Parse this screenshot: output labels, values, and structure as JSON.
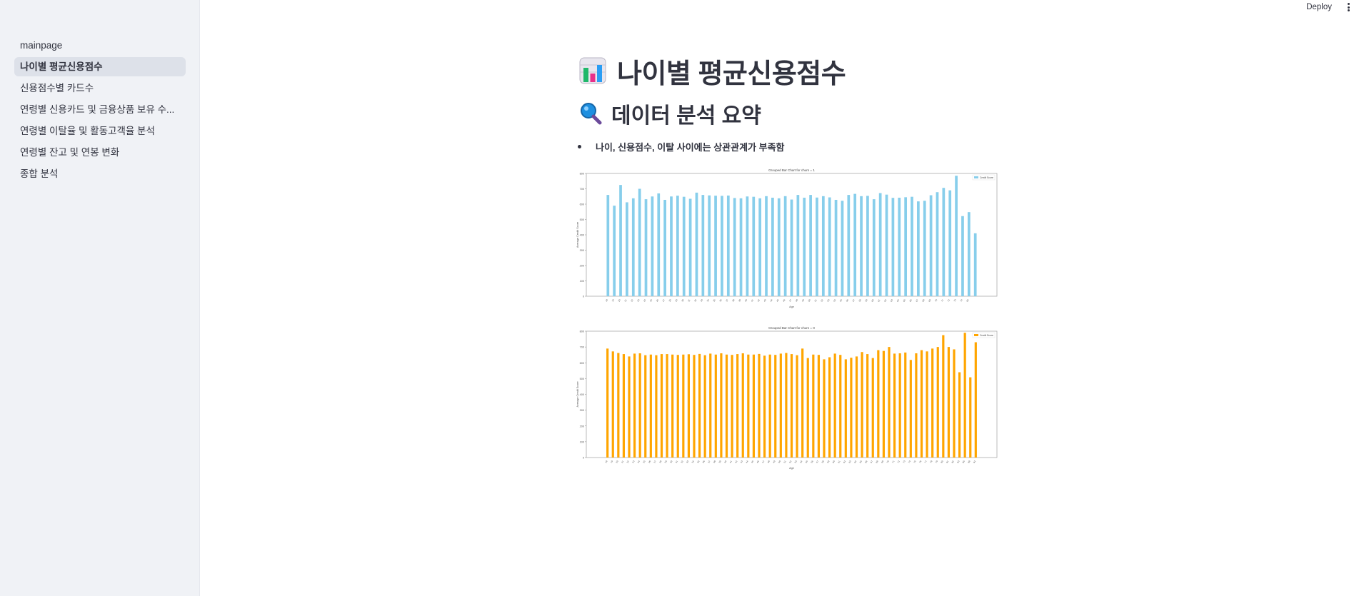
{
  "sidebar": {
    "items": [
      {
        "label": "mainpage",
        "active": false
      },
      {
        "label": "나이별 평균신용점수",
        "active": true
      },
      {
        "label": "신용점수별 카드수",
        "active": false
      },
      {
        "label": "연령별 신용카드 및 금융상품 보유 수...",
        "active": false
      },
      {
        "label": "연령별 이탈율 및 활동고객율 분석",
        "active": false
      },
      {
        "label": "연령별 잔고 및 연봉 변화",
        "active": false
      },
      {
        "label": "종합 분석",
        "active": false
      }
    ]
  },
  "toolbar": {
    "deploy_label": "Deploy",
    "menu_icon": "kebab-menu-icon"
  },
  "main": {
    "title": "나이별 평균신용점수",
    "title_icon": "bar-chart-emoji-icon",
    "subtitle": "데이터 분석 요약",
    "subtitle_icon": "magnifier-emoji-icon",
    "bullets": [
      "나이, 신용점수, 이탈 사이에는 상관관계가 부족함"
    ]
  },
  "chart_data": [
    {
      "type": "bar",
      "title": "Grouped Bar Chart for churn = 1",
      "xlabel": "Age",
      "ylabel": "Average Credit Score",
      "legend": [
        "Credit Score"
      ],
      "legend_position": "top-right",
      "color": "#87ceeb",
      "ylim": [
        0,
        800
      ],
      "yticks": [
        0,
        100,
        200,
        300,
        400,
        500,
        600,
        700,
        800
      ],
      "categories": [
        18,
        19,
        20,
        21,
        22,
        23,
        24,
        25,
        26,
        27,
        28,
        29,
        30,
        31,
        32,
        33,
        34,
        35,
        36,
        37,
        38,
        39,
        40,
        41,
        42,
        43,
        44,
        45,
        46,
        47,
        48,
        49,
        50,
        51,
        52,
        53,
        54,
        55,
        56,
        57,
        58,
        59,
        60,
        61,
        62,
        63,
        64,
        65,
        66,
        67,
        68,
        69,
        70,
        71,
        72,
        73,
        74,
        84
      ],
      "values": [
        660,
        590,
        725,
        612,
        638,
        700,
        632,
        650,
        670,
        628,
        650,
        655,
        648,
        635,
        675,
        660,
        657,
        655,
        654,
        656,
        640,
        638,
        650,
        648,
        638,
        652,
        642,
        638,
        652,
        630,
        660,
        642,
        660,
        643,
        652,
        644,
        628,
        622,
        660,
        667,
        652,
        654,
        632,
        672,
        662,
        641,
        642,
        645,
        648,
        618,
        622,
        658,
        678,
        706,
        690,
        785,
        522,
        548,
        410
      ]
    },
    {
      "type": "bar",
      "title": "Grouped Bar Chart for churn = 0",
      "xlabel": "Age",
      "ylabel": "Average Credit Score",
      "legend": [
        "Credit Score"
      ],
      "legend_position": "top-right",
      "color": "#ffa500",
      "ylim": [
        0,
        800
      ],
      "yticks": [
        0,
        100,
        200,
        300,
        400,
        500,
        600,
        700,
        800
      ],
      "categories": [
        18,
        19,
        20,
        21,
        22,
        23,
        24,
        25,
        26,
        27,
        28,
        29,
        30,
        31,
        32,
        33,
        34,
        35,
        36,
        37,
        38,
        39,
        40,
        41,
        42,
        43,
        44,
        45,
        46,
        47,
        48,
        49,
        50,
        51,
        52,
        53,
        54,
        55,
        56,
        57,
        58,
        59,
        60,
        61,
        62,
        63,
        64,
        65,
        66,
        67,
        68,
        69,
        70,
        71,
        72,
        73,
        74,
        75,
        76,
        77,
        78,
        79,
        80,
        81,
        82,
        83,
        85,
        88,
        92
      ],
      "values": [
        690,
        672,
        662,
        655,
        640,
        658,
        660,
        648,
        652,
        648,
        655,
        655,
        652,
        650,
        652,
        654,
        650,
        656,
        648,
        658,
        652,
        660,
        652,
        650,
        655,
        660,
        652,
        652,
        656,
        645,
        652,
        650,
        658,
        662,
        655,
        648,
        690,
        630,
        652,
        650,
        622,
        635,
        658,
        650,
        622,
        632,
        640,
        668,
        655,
        630,
        680,
        675,
        700,
        658,
        660,
        665,
        618,
        660,
        680,
        672,
        690,
        700,
        775,
        700,
        685,
        540,
        790,
        508,
        730
      ]
    }
  ]
}
